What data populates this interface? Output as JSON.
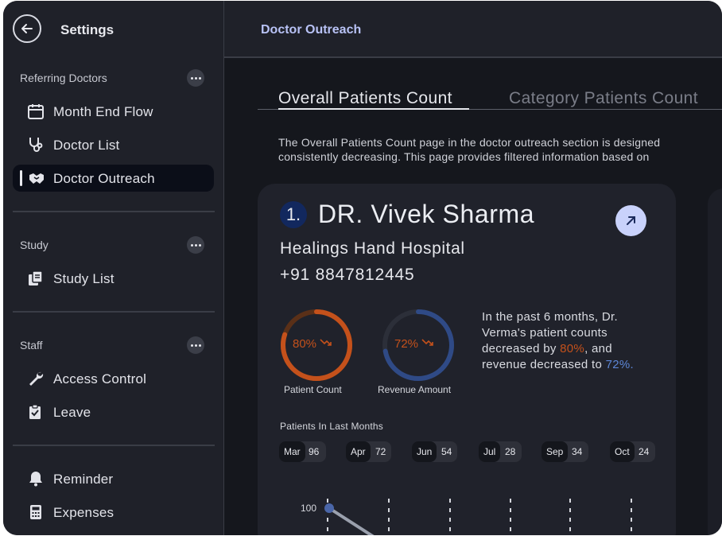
{
  "sidebar": {
    "title": "Settings",
    "sections": [
      {
        "label": "Referring Doctors",
        "items": [
          {
            "label": "Month End Flow",
            "icon": "calendar-icon"
          },
          {
            "label": "Doctor List",
            "icon": "stethoscope-icon"
          },
          {
            "label": "Doctor Outreach",
            "icon": "handshake-icon",
            "active": true
          }
        ]
      },
      {
        "label": "Study",
        "items": [
          {
            "label": "Study List",
            "icon": "files-icon"
          }
        ]
      },
      {
        "label": "Staff",
        "items": [
          {
            "label": "Access Control",
            "icon": "wrench-icon"
          },
          {
            "label": "Leave",
            "icon": "clipboard-check-icon"
          }
        ]
      },
      {
        "label": "",
        "items": [
          {
            "label": "Reminder",
            "icon": "bell-icon"
          },
          {
            "label": "Expenses",
            "icon": "calculator-icon"
          }
        ]
      }
    ]
  },
  "header": {
    "title": "Doctor Outreach"
  },
  "tabs": [
    {
      "label": "Overall Patients Count",
      "active": true
    },
    {
      "label": "Category Patients Count",
      "active": false
    }
  ],
  "description": {
    "line1": "The Overall Patients Count page in the doctor outreach section is designed",
    "line2": "consistently decreasing. This page provides filtered information based on"
  },
  "card": {
    "rank": "1.",
    "doctor_name": "DR. Vivek Sharma",
    "hospital": "Healings Hand Hospital",
    "phone": "+91 8847812445",
    "rings": [
      {
        "value_text": "80%",
        "value": 80,
        "label": "Patient Count",
        "color": "#c4511b",
        "track": "#5a3018"
      },
      {
        "value_text": "72%",
        "value": 72,
        "label": "Revenue Amount",
        "color": "#2f4a86",
        "track": "#2c2f39"
      }
    ],
    "summary": {
      "part1": "In the past 6 months, Dr. Verma's patient counts decreased by ",
      "pct1": "80%",
      "part2": ", and revenue decreased to ",
      "pct2": "72%."
    },
    "months_label": "Patients In Last Months",
    "months": [
      {
        "month": "Mar",
        "value": "96"
      },
      {
        "month": "Apr",
        "value": "72"
      },
      {
        "month": "Jun",
        "value": "54"
      },
      {
        "month": "Jul",
        "value": "28"
      },
      {
        "month": "Sep",
        "value": "34"
      },
      {
        "month": "Oct",
        "value": "24"
      }
    ],
    "chart_first_label": "100"
  },
  "colors": {
    "accent": "#b8c2f5",
    "orange": "#c4511b",
    "blue": "#5c86d6"
  }
}
